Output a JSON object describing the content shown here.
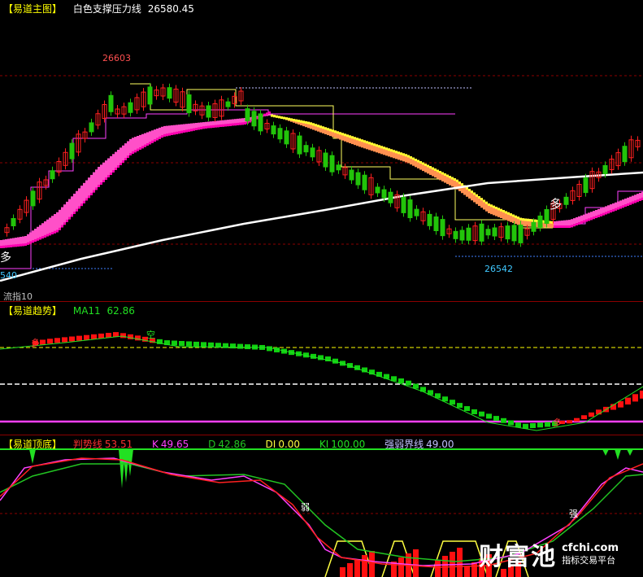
{
  "main_pane": {
    "header": {
      "title": "【易道主图】",
      "line_name": "白色支撑压力线",
      "line_value": "26580.45"
    },
    "labels": {
      "high_price": "26603",
      "low_price": "26542",
      "left_price": "540",
      "left_bottom_text": "流指10",
      "bull_signal_left": "多",
      "bull_signal_right": "多"
    },
    "colors": {
      "up_candle": "#ff2020",
      "down_candle": "#22c40a",
      "support_line": "#ffffff",
      "band_up": "#ff2fbf",
      "band_down": "#ffff33"
    }
  },
  "trend_pane": {
    "header": {
      "title": "【易道趋势】",
      "ma_label": "MA11",
      "ma_value": "62.86"
    },
    "labels": {
      "bull": "多",
      "bear": "空"
    }
  },
  "top_bottom_pane": {
    "header": {
      "title": "【易道顶底】",
      "trend_line_label": "判势线",
      "trend_line_value": "53.51",
      "k_label": "K",
      "k_value": "49.65",
      "d_label": "D",
      "d_value": "42.86",
      "di_label": "DI",
      "di_value": "0.00",
      "ki_label": "KI",
      "ki_value": "100.00",
      "boundary_label": "强弱界线",
      "boundary_value": "49.00"
    },
    "labels": {
      "weak": "弱",
      "strong": "强"
    }
  },
  "watermark": {
    "title": "财富池",
    "domain": "cfchi.com",
    "slogan": "指标交易平台"
  }
}
